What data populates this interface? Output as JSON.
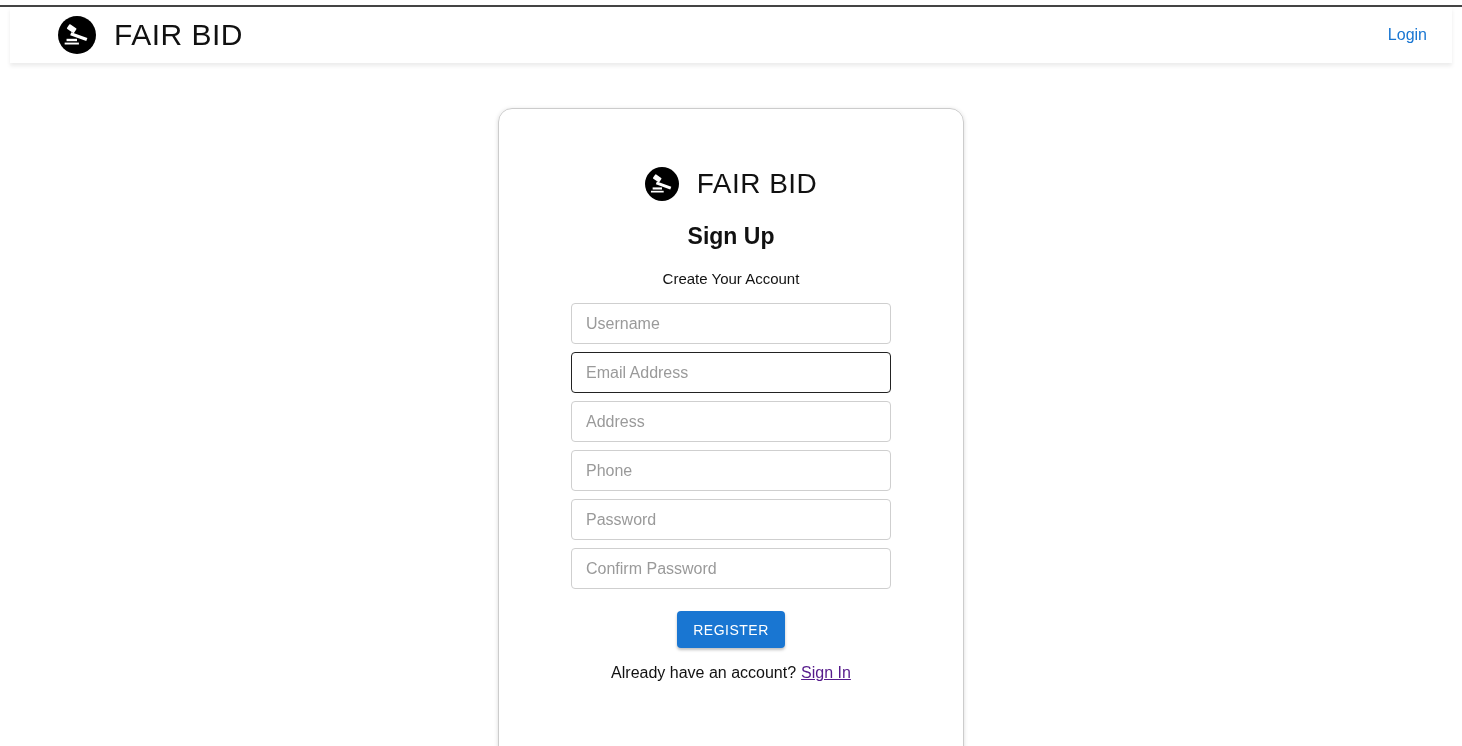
{
  "header": {
    "brand": "FAIR BID",
    "login_link": "Login"
  },
  "card": {
    "brand": "FAIR BID",
    "title": "Sign Up",
    "subtitle": "Create Your Account",
    "fields": [
      {
        "placeholder": "Username",
        "focused": false
      },
      {
        "placeholder": "Email Address",
        "focused": true
      },
      {
        "placeholder": "Address",
        "focused": false
      },
      {
        "placeholder": "Phone",
        "focused": false
      },
      {
        "placeholder": "Password",
        "focused": false
      },
      {
        "placeholder": "Confirm Password",
        "focused": false
      }
    ],
    "register_button": "REGISTER",
    "footer_text": "Already have an account?",
    "signin_link": "Sign In"
  }
}
